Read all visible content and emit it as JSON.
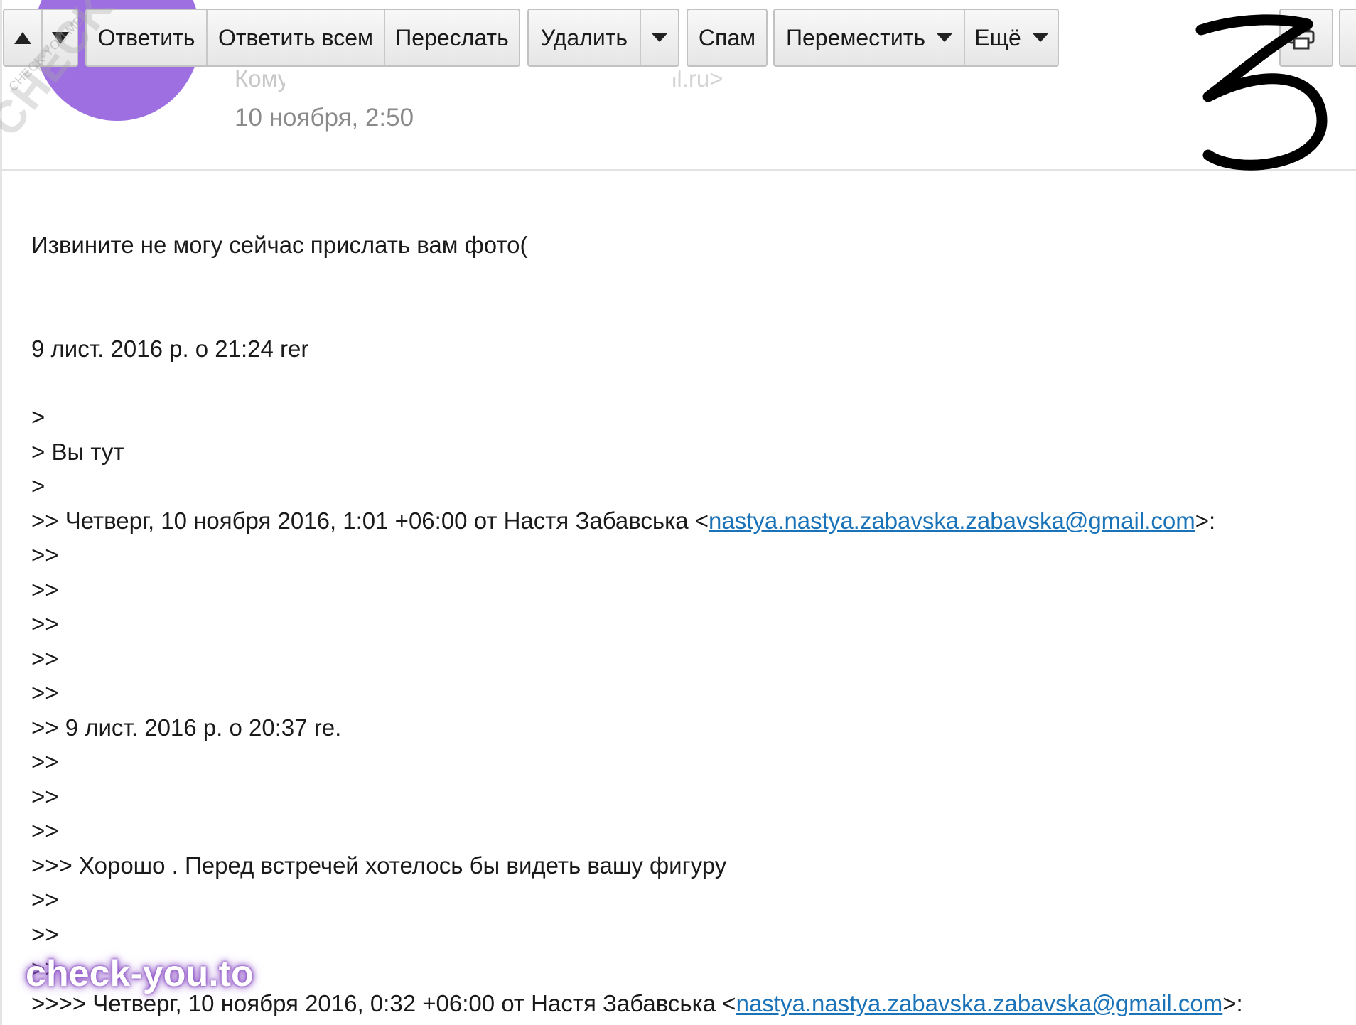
{
  "toolbar": {
    "reply": "Ответить",
    "reply_all": "Ответить всем",
    "forward": "Переслать",
    "delete": "Удалить",
    "spam": "Спам",
    "move": "Переместить",
    "more": "Ещё"
  },
  "header": {
    "to_label": "Кому",
    "to_tail": "il.ru>",
    "date": "10 ноября, 2:50"
  },
  "message": {
    "line_1": "Извините не могу сейчас прислать вам фото(",
    "line_2": "9 лист. 2016 р. о 21:24 rer",
    "q1": ">",
    "q2": "> Вы тут",
    "q3": ">",
    "q4_prefix": ">> Четверг, 10 ноября 2016, 1:01 +06:00 от Настя Забавська <",
    "q4_email": "nastya.nastya.zabavska.zabavska@gmail.com",
    "q4_suffix": ">:",
    "q5": ">>",
    "q6": ">>",
    "q7": ">>",
    "q8": ">>",
    "q9": ">>",
    "q10": ">> 9 лист. 2016 р. о 20:37 re.",
    "q11": ">>",
    "q12": ">>",
    "q13": ">>",
    "q14": ">>> Хорошо . Перед встречей хотелось бы видеть вашу фигуру",
    "q15": ">>",
    "q16": ">>",
    "q17": ">>",
    "q18_prefix": ">>>> Четверг, 10 ноября 2016, 0:32 +06:00 от Настя Забавська <",
    "q18_email": "nastya.nastya.zabavska.zabavska@gmail.com",
    "q18_suffix": ">:"
  },
  "overlay": {
    "watermark_diag": "CHECK-YOU.ME",
    "watermark_small": "CHECK-YOU.ME",
    "watermark_bottom": "check-you.to",
    "handwritten_number": "3"
  },
  "icons": {
    "nav_up": "triangle-up",
    "nav_down": "triangle-down",
    "dropdown": "caret-down",
    "print": "printer"
  },
  "colors": {
    "link": "#1a73b8",
    "avatar": "#9d6fe0",
    "watermark_glow": "#8c4fc7"
  }
}
